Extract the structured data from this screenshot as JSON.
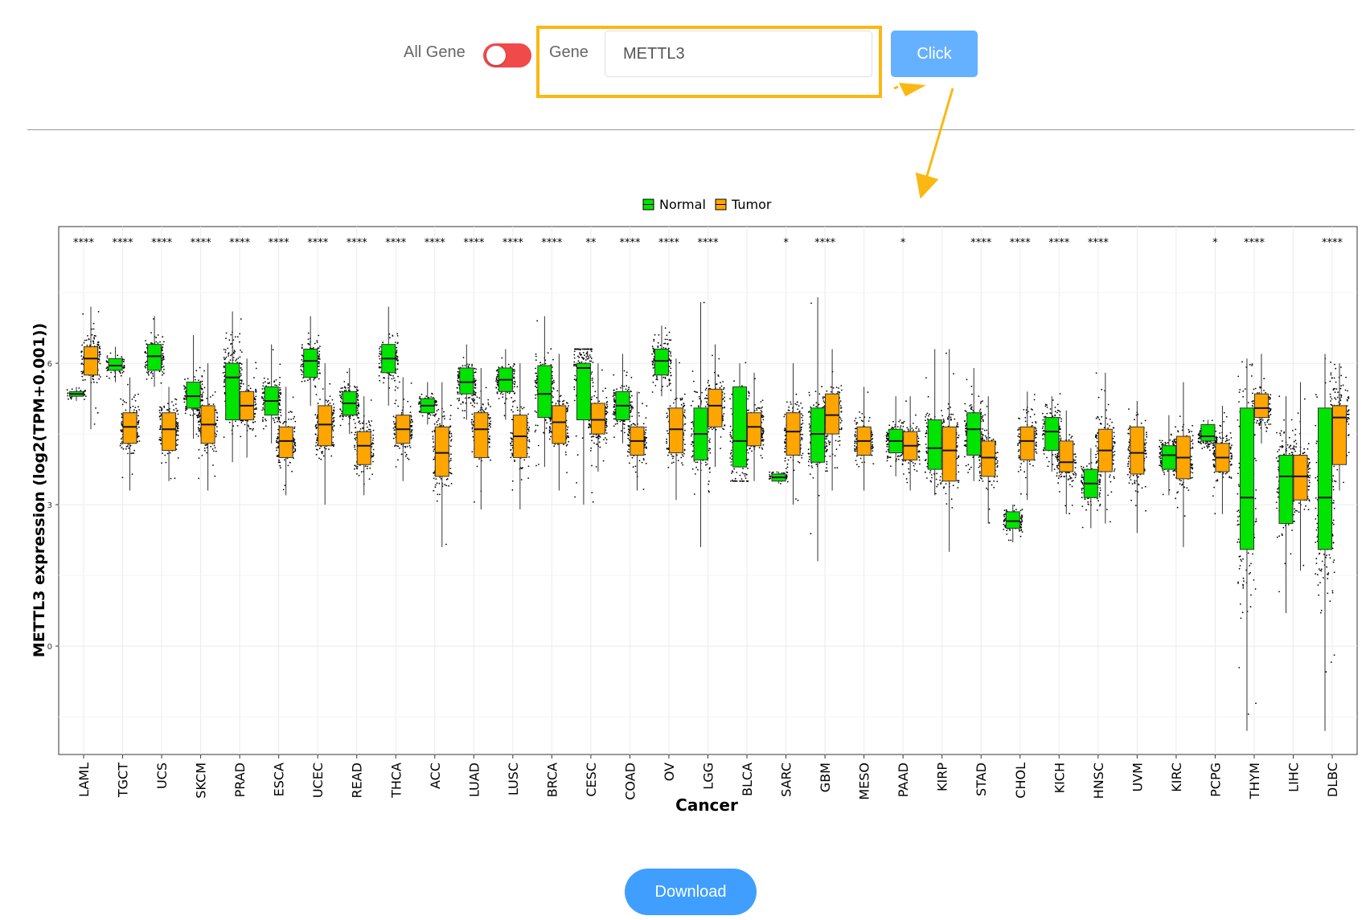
{
  "toolbar": {
    "all_gene_label": "All Gene",
    "gene_label": "Gene",
    "gene_value": "METTL3",
    "click_label": "Click"
  },
  "download_label": "Download",
  "colors": {
    "normal": "#00e400",
    "tumor": "#ffa500",
    "highlight": "#fbb813",
    "toggle": "#f04a4a",
    "button": "#409eff"
  },
  "chart_data": {
    "type": "box",
    "title": "",
    "xlabel": "Cancer",
    "ylabel": "METTL3 expression (log2(TPM+0.001))",
    "ylim": [
      -2.3,
      8.9
    ],
    "yticks": [
      0,
      3,
      6
    ],
    "legend_position": "top",
    "legend": [
      {
        "name": "Normal",
        "color": "#00e400"
      },
      {
        "name": "Tumor",
        "color": "#ffa500"
      }
    ],
    "categories": [
      {
        "name": "LAML",
        "sig": "****",
        "normal": {
          "q1": 5.3,
          "med": 5.35,
          "q3": 5.4,
          "lo": 5.2,
          "hi": 5.5
        },
        "tumor": {
          "q1": 5.75,
          "med": 6.1,
          "q3": 6.35,
          "lo": 4.6,
          "hi": 7.2
        }
      },
      {
        "name": "TGCT",
        "sig": "****",
        "normal": {
          "q1": 5.85,
          "med": 5.95,
          "q3": 6.1,
          "lo": 5.6,
          "hi": 6.35
        },
        "tumor": {
          "q1": 4.3,
          "med": 4.65,
          "q3": 4.95,
          "lo": 3.3,
          "hi": 5.7
        }
      },
      {
        "name": "UCS",
        "sig": "****",
        "normal": {
          "q1": 5.85,
          "med": 6.15,
          "q3": 6.4,
          "lo": 5.5,
          "hi": 7.0
        },
        "tumor": {
          "q1": 4.15,
          "med": 4.6,
          "q3": 4.95,
          "lo": 3.5,
          "hi": 5.5
        }
      },
      {
        "name": "SKCM",
        "sig": "****",
        "normal": {
          "q1": 5.05,
          "med": 5.3,
          "q3": 5.6,
          "lo": 4.4,
          "hi": 6.6
        },
        "tumor": {
          "q1": 4.3,
          "med": 4.7,
          "q3": 5.1,
          "lo": 3.3,
          "hi": 6.0
        }
      },
      {
        "name": "PRAD",
        "sig": "****",
        "normal": {
          "q1": 4.8,
          "med": 5.7,
          "q3": 6.0,
          "lo": 3.9,
          "hi": 7.1
        },
        "tumor": {
          "q1": 4.8,
          "med": 5.1,
          "q3": 5.4,
          "lo": 4.0,
          "hi": 6.1
        }
      },
      {
        "name": "ESCA",
        "sig": "****",
        "normal": {
          "q1": 4.9,
          "med": 5.2,
          "q3": 5.5,
          "lo": 4.3,
          "hi": 6.4
        },
        "tumor": {
          "q1": 4.0,
          "med": 4.35,
          "q3": 4.65,
          "lo": 3.2,
          "hi": 5.5
        }
      },
      {
        "name": "UCEC",
        "sig": "****",
        "normal": {
          "q1": 5.7,
          "med": 6.05,
          "q3": 6.3,
          "lo": 5.1,
          "hi": 7.0
        },
        "tumor": {
          "q1": 4.25,
          "med": 4.7,
          "q3": 5.1,
          "lo": 3.0,
          "hi": 6.0
        }
      },
      {
        "name": "READ",
        "sig": "****",
        "normal": {
          "q1": 4.9,
          "med": 5.15,
          "q3": 5.4,
          "lo": 4.5,
          "hi": 5.9
        },
        "tumor": {
          "q1": 3.85,
          "med": 4.25,
          "q3": 4.55,
          "lo": 3.2,
          "hi": 5.3
        }
      },
      {
        "name": "THCA",
        "sig": "****",
        "normal": {
          "q1": 5.8,
          "med": 6.1,
          "q3": 6.4,
          "lo": 5.1,
          "hi": 7.2
        },
        "tumor": {
          "q1": 4.3,
          "med": 4.6,
          "q3": 4.9,
          "lo": 3.5,
          "hi": 5.7
        }
      },
      {
        "name": "ACC",
        "sig": "****",
        "normal": {
          "q1": 4.95,
          "med": 5.1,
          "q3": 5.25,
          "lo": 4.7,
          "hi": 5.6
        },
        "tumor": {
          "q1": 3.6,
          "med": 4.1,
          "q3": 4.65,
          "lo": 2.1,
          "hi": 5.6
        }
      },
      {
        "name": "LUAD",
        "sig": "****",
        "normal": {
          "q1": 5.35,
          "med": 5.6,
          "q3": 5.9,
          "lo": 4.8,
          "hi": 6.4
        },
        "tumor": {
          "q1": 4.0,
          "med": 4.6,
          "q3": 4.95,
          "lo": 2.9,
          "hi": 5.9
        }
      },
      {
        "name": "LUSC",
        "sig": "****",
        "normal": {
          "q1": 5.4,
          "med": 5.65,
          "q3": 5.9,
          "lo": 4.8,
          "hi": 6.3
        },
        "tumor": {
          "q1": 4.0,
          "med": 4.45,
          "q3": 4.9,
          "lo": 2.9,
          "hi": 6.0
        }
      },
      {
        "name": "BRCA",
        "sig": "****",
        "normal": {
          "q1": 4.85,
          "med": 5.35,
          "q3": 5.95,
          "lo": 3.8,
          "hi": 7.0
        },
        "tumor": {
          "q1": 4.3,
          "med": 4.75,
          "q3": 5.1,
          "lo": 3.3,
          "hi": 6.2
        }
      },
      {
        "name": "CESC",
        "sig": "**",
        "normal": {
          "q1": 4.8,
          "med": 5.9,
          "q3": 6.0,
          "lo": 3.0,
          "hi": 6.0
        },
        "tumor": {
          "q1": 4.5,
          "med": 4.8,
          "q3": 5.15,
          "lo": 3.7,
          "hi": 6.0
        }
      },
      {
        "name": "COAD",
        "sig": "****",
        "normal": {
          "q1": 4.8,
          "med": 5.1,
          "q3": 5.4,
          "lo": 4.3,
          "hi": 6.2
        },
        "tumor": {
          "q1": 4.05,
          "med": 4.35,
          "q3": 4.65,
          "lo": 3.3,
          "hi": 5.4
        }
      },
      {
        "name": "OV",
        "sig": "****",
        "normal": {
          "q1": 5.75,
          "med": 6.05,
          "q3": 6.3,
          "lo": 5.3,
          "hi": 6.8
        },
        "tumor": {
          "q1": 4.1,
          "med": 4.6,
          "q3": 5.05,
          "lo": 3.1,
          "hi": 6.1
        }
      },
      {
        "name": "LGG",
        "sig": "****",
        "normal": {
          "q1": 3.95,
          "med": 4.5,
          "q3": 5.05,
          "lo": 2.1,
          "hi": 7.3
        },
        "tumor": {
          "q1": 4.65,
          "med": 5.1,
          "q3": 5.45,
          "lo": 3.8,
          "hi": 6.4
        }
      },
      {
        "name": "BLCA",
        "sig": "",
        "normal": {
          "q1": 3.8,
          "med": 4.35,
          "q3": 5.5,
          "lo": 3.8,
          "hi": 6.0
        },
        "tumor": {
          "q1": 4.25,
          "med": 4.65,
          "q3": 4.95,
          "lo": 3.5,
          "hi": 5.8
        }
      },
      {
        "name": "SARC",
        "sig": "*",
        "normal": {
          "q1": 3.5,
          "med": 3.58,
          "q3": 3.65,
          "lo": 3.45,
          "hi": 3.7
        },
        "tumor": {
          "q1": 4.05,
          "med": 4.55,
          "q3": 4.95,
          "lo": 3.0,
          "hi": 6.0
        }
      },
      {
        "name": "GBM",
        "sig": "****",
        "normal": {
          "q1": 3.9,
          "med": 4.5,
          "q3": 5.05,
          "lo": 1.8,
          "hi": 7.4
        },
        "tumor": {
          "q1": 4.5,
          "med": 4.9,
          "q3": 5.35,
          "lo": 3.3,
          "hi": 6.3
        }
      },
      {
        "name": "MESO",
        "sig": "",
        "normal": null,
        "tumor": {
          "q1": 4.05,
          "med": 4.35,
          "q3": 4.65,
          "lo": 3.3,
          "hi": 5.5
        }
      },
      {
        "name": "PAAD",
        "sig": "*",
        "normal": {
          "q1": 4.1,
          "med": 4.35,
          "q3": 4.6,
          "lo": 3.6,
          "hi": 5.3
        },
        "tumor": {
          "q1": 3.95,
          "med": 4.25,
          "q3": 4.55,
          "lo": 3.3,
          "hi": 5.3
        }
      },
      {
        "name": "KIRP",
        "sig": "",
        "normal": {
          "q1": 3.75,
          "med": 4.2,
          "q3": 4.8,
          "lo": 3.2,
          "hi": 6.3
        },
        "tumor": {
          "q1": 3.5,
          "med": 4.15,
          "q3": 4.65,
          "lo": 2.0,
          "hi": 6.3
        }
      },
      {
        "name": "STAD",
        "sig": "****",
        "normal": {
          "q1": 4.05,
          "med": 4.6,
          "q3": 4.95,
          "lo": 3.5,
          "hi": 5.9
        },
        "tumor": {
          "q1": 3.6,
          "med": 4.0,
          "q3": 4.35,
          "lo": 2.6,
          "hi": 5.3
        }
      },
      {
        "name": "CHOL",
        "sig": "****",
        "normal": {
          "q1": 2.5,
          "med": 2.65,
          "q3": 2.85,
          "lo": 2.2,
          "hi": 3.0
        },
        "tumor": {
          "q1": 3.95,
          "med": 4.35,
          "q3": 4.65,
          "lo": 3.1,
          "hi": 5.4
        }
      },
      {
        "name": "KICH",
        "sig": "****",
        "normal": {
          "q1": 4.15,
          "med": 4.55,
          "q3": 4.85,
          "lo": 3.7,
          "hi": 5.3
        },
        "tumor": {
          "q1": 3.7,
          "med": 3.9,
          "q3": 4.35,
          "lo": 2.8,
          "hi": 5.0
        }
      },
      {
        "name": "HNSC",
        "sig": "****",
        "normal": {
          "q1": 3.15,
          "med": 3.45,
          "q3": 3.75,
          "lo": 2.5,
          "hi": 4.2
        },
        "tumor": {
          "q1": 3.7,
          "med": 4.15,
          "q3": 4.6,
          "lo": 2.6,
          "hi": 5.8
        }
      },
      {
        "name": "UVM",
        "sig": "",
        "normal": null,
        "tumor": {
          "q1": 3.65,
          "med": 4.1,
          "q3": 4.65,
          "lo": 2.4,
          "hi": 5.2
        }
      },
      {
        "name": "KIRC",
        "sig": "",
        "normal": {
          "q1": 3.75,
          "med": 4.05,
          "q3": 4.25,
          "lo": 3.2,
          "hi": 4.9
        },
        "tumor": {
          "q1": 3.55,
          "med": 4.0,
          "q3": 4.45,
          "lo": 2.1,
          "hi": 5.6
        }
      },
      {
        "name": "PCPG",
        "sig": "*",
        "normal": {
          "q1": 4.35,
          "med": 4.45,
          "q3": 4.7,
          "lo": 4.2,
          "hi": 4.8
        },
        "tumor": {
          "q1": 3.7,
          "med": 4.0,
          "q3": 4.3,
          "lo": 2.8,
          "hi": 5.1
        }
      },
      {
        "name": "THYM",
        "sig": "****",
        "normal": {
          "q1": 2.05,
          "med": 3.15,
          "q3": 5.05,
          "lo": -1.8,
          "hi": 6.1
        },
        "tumor": {
          "q1": 4.85,
          "med": 5.05,
          "q3": 5.35,
          "lo": 4.3,
          "hi": 6.2
        }
      },
      {
        "name": "LIHC",
        "sig": "",
        "normal": {
          "q1": 2.6,
          "med": 3.6,
          "q3": 4.05,
          "lo": 0.7,
          "hi": 5.3
        },
        "tumor": {
          "q1": 3.1,
          "med": 3.6,
          "q3": 4.05,
          "lo": 1.6,
          "hi": 5.6
        }
      },
      {
        "name": "DLBC",
        "sig": "****",
        "normal": {
          "q1": 2.05,
          "med": 3.15,
          "q3": 5.05,
          "lo": -1.8,
          "hi": 6.2
        },
        "tumor": {
          "q1": 3.85,
          "med": 4.85,
          "q3": 5.1,
          "lo": 3.3,
          "hi": 6.0
        }
      }
    ]
  }
}
